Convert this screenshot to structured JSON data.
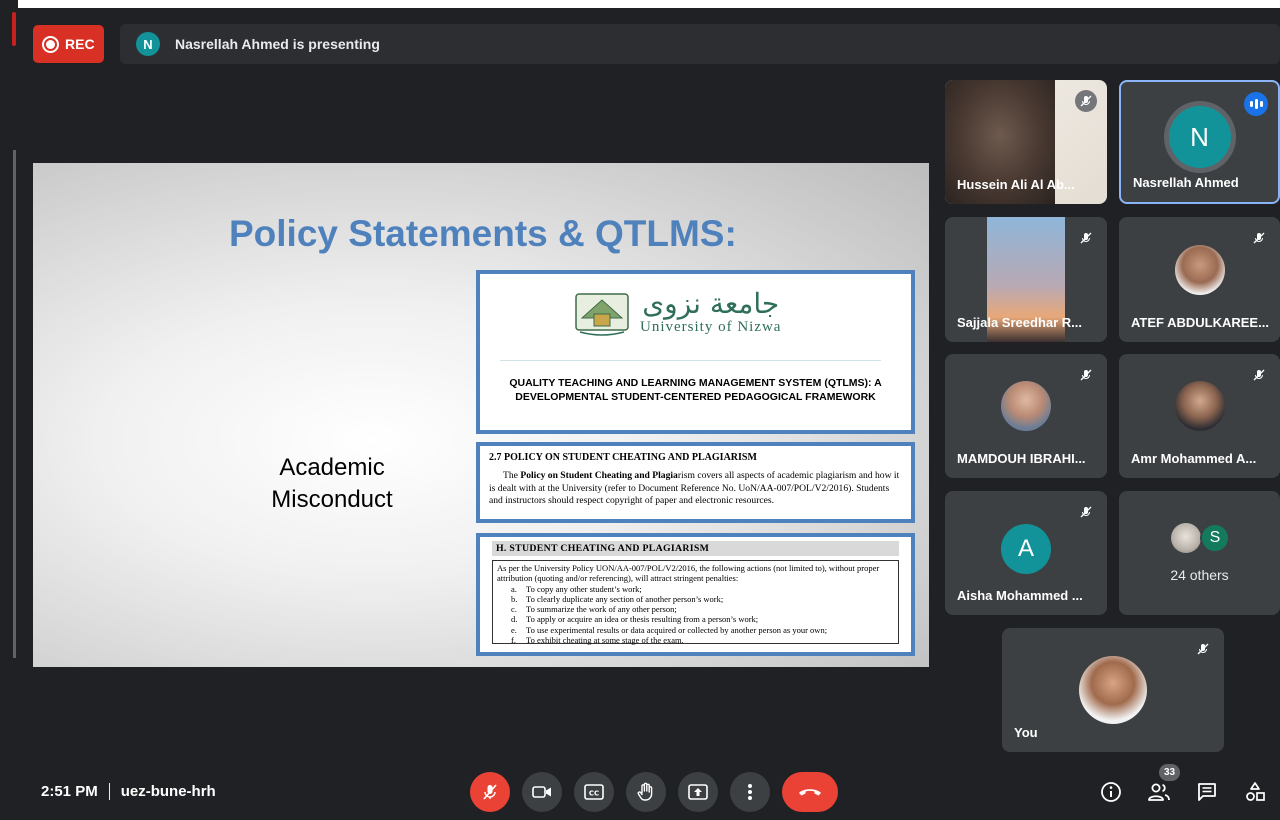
{
  "recording": {
    "label": "REC"
  },
  "presenter_banner": {
    "avatar_letter": "N",
    "text": "Nasrellah Ahmed is presenting"
  },
  "slide": {
    "title": "Policy Statements & QTLMS:",
    "side_line1": "Academic",
    "side_line2": "Misconduct",
    "doc1": {
      "logo_arabic": "جامعة نزوى",
      "logo_english": "University of Nizwa",
      "heading": "QUALITY TEACHING AND LEARNING MANAGEMENT SYSTEM (QTLMS): A DEVELOPMENTAL STUDENT-CENTERED PEDAGOGICAL FRAMEWORK"
    },
    "doc2": {
      "heading": "2.7 POLICY ON STUDENT CHEATING AND PLAGIARISM",
      "body_prefix": "The ",
      "body_bold": "Policy on Student Cheating and Plagia",
      "body_rest": "rism covers all aspects of academic plagiarism and how it is dealt with at the University (refer to Document Reference No. UoN/AA-007/POL/V2/2016). Students and instructors should respect copyright of paper and electronic resources."
    },
    "doc3": {
      "heading": "H.  STUDENT CHEATING AND PLAGIARISM",
      "intro": "As per the University Policy  UON/AA-007/POL/V2/2016, the following actions (not limited to), without proper attribution (quoting and/or referencing), will attract stringent penalties:",
      "items": [
        {
          "mark": "a.",
          "text": "To copy any other student’s work;"
        },
        {
          "mark": "b.",
          "text": "To clearly duplicate any section of another person’s work;"
        },
        {
          "mark": "c.",
          "text": "To summarize the work of any other person;"
        },
        {
          "mark": "d.",
          "text": "To apply or acquire an idea or thesis resulting from a person’s work;"
        },
        {
          "mark": "e.",
          "text": "To use experimental results or data acquired or collected by another person as your own;"
        },
        {
          "mark": "f.",
          "text": "To exhibit cheating at some stage of the exam."
        }
      ]
    }
  },
  "participants": {
    "hussein": {
      "name": "Hussein Ali Al Ab..."
    },
    "nasrellah": {
      "name": "Nasrellah Ahmed",
      "letter": "N"
    },
    "sajjala": {
      "name": "Sajjala Sreedhar R..."
    },
    "atef": {
      "name": "ATEF ABDULKAREE..."
    },
    "mamdouh": {
      "name": "MAMDOUH IBRAHI..."
    },
    "amr": {
      "name": "Amr Mohammed A..."
    },
    "aisha": {
      "name": "Aisha Mohammed ...",
      "letter": "A"
    },
    "others": {
      "label": "24 others",
      "letter": "S"
    },
    "you": {
      "name": "You"
    }
  },
  "bottom": {
    "time": "2:51 PM",
    "meeting_code": "uez-bune-hrh",
    "people_count": "33"
  },
  "colors": {
    "accent_blue": "#1a73e8",
    "danger_red": "#ea4335",
    "avatar_teal": "#12939a",
    "slide_title_blue": "#4f81bd"
  }
}
